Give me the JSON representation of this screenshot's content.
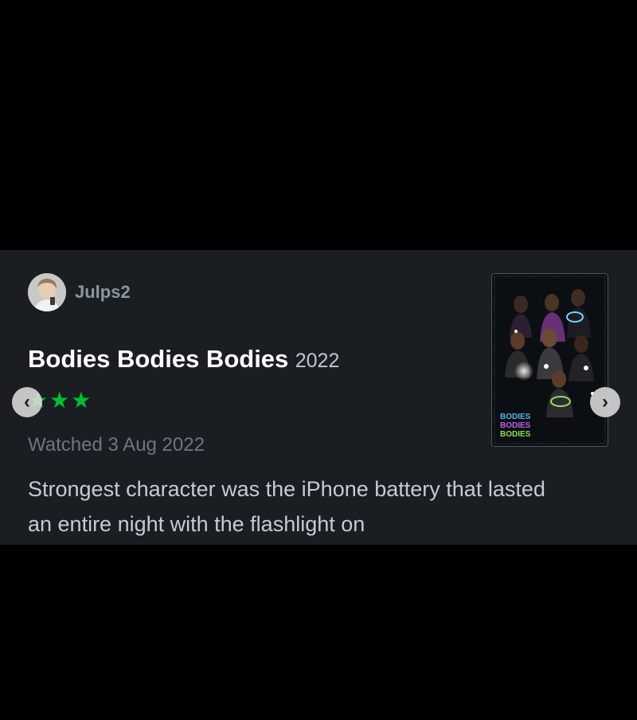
{
  "review": {
    "username": "Julps2",
    "film_title": "Bodies Bodies Bodies",
    "film_year": "2022",
    "rating_stars": "★★★",
    "watched_date": "Watched 3 Aug 2022",
    "text": "Strongest character was the iPhone battery that lasted an entire night with the flashlight on"
  },
  "poster": {
    "title_lines": [
      "BODIES",
      "BODIES",
      "BODIES"
    ],
    "title_colors": [
      "#4fb6e8",
      "#c25ee6",
      "#88e04f"
    ]
  },
  "navigation": {
    "prev_icon": "chevron-left-icon",
    "next_icon": "chevron-right-icon",
    "prev_glyph": "‹",
    "next_glyph": "›"
  },
  "colors": {
    "background": "#000000",
    "card": "#1a1e22",
    "star": "#00c030",
    "username": "#8a96a3"
  }
}
